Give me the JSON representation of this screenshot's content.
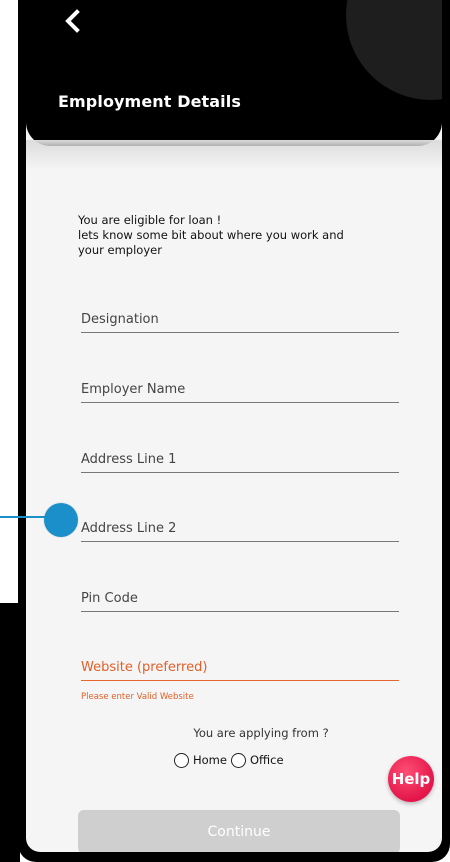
{
  "header": {
    "title": "Employment Details",
    "back_icon": "chevron-left-icon"
  },
  "intro": {
    "line1": "You are eligible for loan !",
    "line2": "lets know some bit about where you work and",
    "line3": "your employer"
  },
  "form": {
    "designation_placeholder": "Designation",
    "employer_name_placeholder": "Employer Name",
    "address_line1_placeholder": "Address Line 1",
    "address_line2_placeholder": "Address Line 2",
    "pin_code_placeholder": "Pin Code",
    "website_placeholder": "Website (preferred)",
    "website_error": "Please enter Valid Website"
  },
  "applying_from": {
    "label": "You are applying from ?",
    "options": [
      "Home",
      "Office"
    ]
  },
  "help_button": {
    "label": "Help"
  },
  "continue_button": {
    "label": "Continue"
  },
  "colors": {
    "header_bg": "#000000",
    "error": "#e0602a",
    "help_bg": "#e3154a",
    "annotation_marker": "#1a8fca",
    "continue_disabled": "#cfcfcf"
  }
}
